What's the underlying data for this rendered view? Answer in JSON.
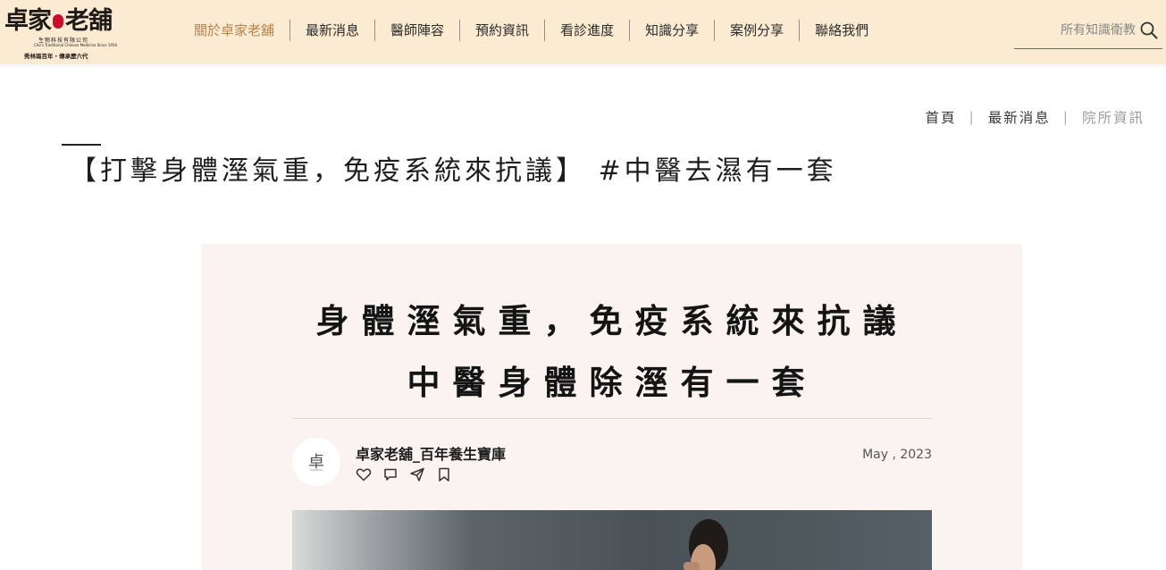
{
  "brand": {
    "name_part1": "卓家",
    "name_part2": "老舖",
    "company_line": "生物科技有限公司",
    "english_line": "Cho's Traditional Chinese Medicine Since 1956",
    "slogan": "秀林兩百年・傳承歷六代"
  },
  "nav": {
    "items": [
      {
        "label": "關於卓家老舖",
        "active": true
      },
      {
        "label": "最新消息"
      },
      {
        "label": "醫師陣容"
      },
      {
        "label": "預約資訊"
      },
      {
        "label": "看診進度"
      },
      {
        "label": "知識分享"
      },
      {
        "label": "案例分享"
      },
      {
        "label": "聯絡我們"
      }
    ],
    "active_color": "#b98148"
  },
  "search": {
    "placeholder": "所有知識衛教",
    "icon": "search-icon"
  },
  "breadcrumb": {
    "home": "首頁",
    "section": "最新消息",
    "current": "院所資訊",
    "separator": "|"
  },
  "article": {
    "title": "【打擊身體溼氣重，免疫系統來抗議】 #中醫去濕有一套"
  },
  "image_card": {
    "headline_line1": "身體溼氣重，免疫系統來抗議",
    "headline_line2": "中醫身體除溼有一套",
    "author": "卓家老舖_百年養生寶庫",
    "date": "May , 2023",
    "actions": [
      "heart-icon",
      "comment-icon",
      "share-icon",
      "bookmark-icon"
    ]
  },
  "colors": {
    "header_bg": "#fbebd2",
    "card_bg": "#fbf3ef",
    "accent": "#b98148"
  }
}
